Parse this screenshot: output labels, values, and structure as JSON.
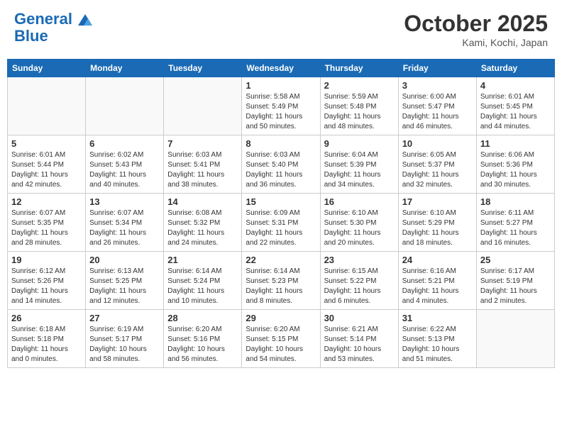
{
  "header": {
    "logo_line1": "General",
    "logo_line2": "Blue",
    "month": "October 2025",
    "location": "Kami, Kochi, Japan"
  },
  "days_of_week": [
    "Sunday",
    "Monday",
    "Tuesday",
    "Wednesday",
    "Thursday",
    "Friday",
    "Saturday"
  ],
  "weeks": [
    [
      {
        "day": "",
        "info": ""
      },
      {
        "day": "",
        "info": ""
      },
      {
        "day": "",
        "info": ""
      },
      {
        "day": "1",
        "info": "Sunrise: 5:58 AM\nSunset: 5:49 PM\nDaylight: 11 hours\nand 50 minutes."
      },
      {
        "day": "2",
        "info": "Sunrise: 5:59 AM\nSunset: 5:48 PM\nDaylight: 11 hours\nand 48 minutes."
      },
      {
        "day": "3",
        "info": "Sunrise: 6:00 AM\nSunset: 5:47 PM\nDaylight: 11 hours\nand 46 minutes."
      },
      {
        "day": "4",
        "info": "Sunrise: 6:01 AM\nSunset: 5:45 PM\nDaylight: 11 hours\nand 44 minutes."
      }
    ],
    [
      {
        "day": "5",
        "info": "Sunrise: 6:01 AM\nSunset: 5:44 PM\nDaylight: 11 hours\nand 42 minutes."
      },
      {
        "day": "6",
        "info": "Sunrise: 6:02 AM\nSunset: 5:43 PM\nDaylight: 11 hours\nand 40 minutes."
      },
      {
        "day": "7",
        "info": "Sunrise: 6:03 AM\nSunset: 5:41 PM\nDaylight: 11 hours\nand 38 minutes."
      },
      {
        "day": "8",
        "info": "Sunrise: 6:03 AM\nSunset: 5:40 PM\nDaylight: 11 hours\nand 36 minutes."
      },
      {
        "day": "9",
        "info": "Sunrise: 6:04 AM\nSunset: 5:39 PM\nDaylight: 11 hours\nand 34 minutes."
      },
      {
        "day": "10",
        "info": "Sunrise: 6:05 AM\nSunset: 5:37 PM\nDaylight: 11 hours\nand 32 minutes."
      },
      {
        "day": "11",
        "info": "Sunrise: 6:06 AM\nSunset: 5:36 PM\nDaylight: 11 hours\nand 30 minutes."
      }
    ],
    [
      {
        "day": "12",
        "info": "Sunrise: 6:07 AM\nSunset: 5:35 PM\nDaylight: 11 hours\nand 28 minutes."
      },
      {
        "day": "13",
        "info": "Sunrise: 6:07 AM\nSunset: 5:34 PM\nDaylight: 11 hours\nand 26 minutes."
      },
      {
        "day": "14",
        "info": "Sunrise: 6:08 AM\nSunset: 5:32 PM\nDaylight: 11 hours\nand 24 minutes."
      },
      {
        "day": "15",
        "info": "Sunrise: 6:09 AM\nSunset: 5:31 PM\nDaylight: 11 hours\nand 22 minutes."
      },
      {
        "day": "16",
        "info": "Sunrise: 6:10 AM\nSunset: 5:30 PM\nDaylight: 11 hours\nand 20 minutes."
      },
      {
        "day": "17",
        "info": "Sunrise: 6:10 AM\nSunset: 5:29 PM\nDaylight: 11 hours\nand 18 minutes."
      },
      {
        "day": "18",
        "info": "Sunrise: 6:11 AM\nSunset: 5:27 PM\nDaylight: 11 hours\nand 16 minutes."
      }
    ],
    [
      {
        "day": "19",
        "info": "Sunrise: 6:12 AM\nSunset: 5:26 PM\nDaylight: 11 hours\nand 14 minutes."
      },
      {
        "day": "20",
        "info": "Sunrise: 6:13 AM\nSunset: 5:25 PM\nDaylight: 11 hours\nand 12 minutes."
      },
      {
        "day": "21",
        "info": "Sunrise: 6:14 AM\nSunset: 5:24 PM\nDaylight: 11 hours\nand 10 minutes."
      },
      {
        "day": "22",
        "info": "Sunrise: 6:14 AM\nSunset: 5:23 PM\nDaylight: 11 hours\nand 8 minutes."
      },
      {
        "day": "23",
        "info": "Sunrise: 6:15 AM\nSunset: 5:22 PM\nDaylight: 11 hours\nand 6 minutes."
      },
      {
        "day": "24",
        "info": "Sunrise: 6:16 AM\nSunset: 5:21 PM\nDaylight: 11 hours\nand 4 minutes."
      },
      {
        "day": "25",
        "info": "Sunrise: 6:17 AM\nSunset: 5:19 PM\nDaylight: 11 hours\nand 2 minutes."
      }
    ],
    [
      {
        "day": "26",
        "info": "Sunrise: 6:18 AM\nSunset: 5:18 PM\nDaylight: 11 hours\nand 0 minutes."
      },
      {
        "day": "27",
        "info": "Sunrise: 6:19 AM\nSunset: 5:17 PM\nDaylight: 10 hours\nand 58 minutes."
      },
      {
        "day": "28",
        "info": "Sunrise: 6:20 AM\nSunset: 5:16 PM\nDaylight: 10 hours\nand 56 minutes."
      },
      {
        "day": "29",
        "info": "Sunrise: 6:20 AM\nSunset: 5:15 PM\nDaylight: 10 hours\nand 54 minutes."
      },
      {
        "day": "30",
        "info": "Sunrise: 6:21 AM\nSunset: 5:14 PM\nDaylight: 10 hours\nand 53 minutes."
      },
      {
        "day": "31",
        "info": "Sunrise: 6:22 AM\nSunset: 5:13 PM\nDaylight: 10 hours\nand 51 minutes."
      },
      {
        "day": "",
        "info": ""
      }
    ]
  ]
}
